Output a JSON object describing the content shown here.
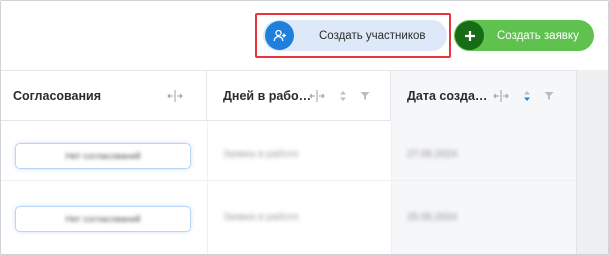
{
  "toolbar": {
    "participants_button": {
      "label": "Создать участников",
      "icon": "add-user-icon"
    },
    "create_button": {
      "label": "Создать заявку",
      "icon": "plus-icon"
    }
  },
  "colors": {
    "highlight": "#e4363b",
    "primary_blue": "#1e7fdc",
    "participants_bg": "#dde9f8",
    "create_green": "#5fc24f",
    "create_green_dark": "#186c17"
  },
  "table": {
    "columns": [
      {
        "title": "Согласования",
        "controls": [
          "resize-icon"
        ]
      },
      {
        "title": "Дней в рабо…",
        "controls": [
          "resize-icon",
          "sort-icon",
          "filter-icon"
        ]
      },
      {
        "title": "Дата созда…",
        "controls": [
          "resize-icon",
          "sort-icon",
          "filter-icon"
        ],
        "sorted": "desc"
      }
    ],
    "rows": [
      {
        "approval": "Нет согласований",
        "days": "Заявка в работе",
        "date": "27.05.2024"
      },
      {
        "approval": "Нет согласований",
        "days": "Заявка в работе",
        "date": "25.05.2024"
      }
    ]
  }
}
